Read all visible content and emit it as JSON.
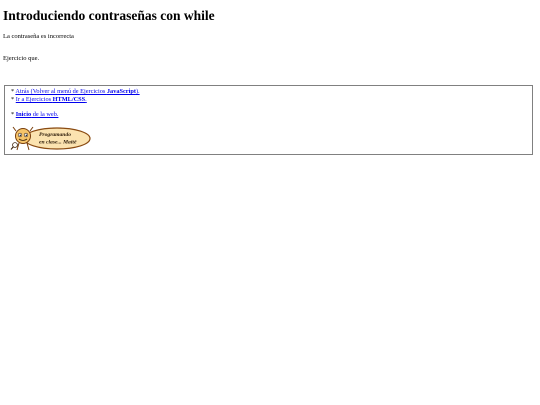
{
  "heading": "Introduciendo contraseñas con while",
  "message": "La contraseña es incorrecta",
  "exercise_text": "Ejercicio que.",
  "nav": {
    "bullet": "*",
    "back_link_text": "Atrás (Volver al menú de Ejercicios ",
    "back_link_bold": "JavaScript",
    "back_link_end": ").",
    "html_link_text": "Ir a Ejercicios ",
    "html_link_bold": "HTML/CSS",
    "html_link_end": ".",
    "home_link_bold": "Inicio",
    "home_link_text": " de la web."
  },
  "badge": {
    "line1": "Programando",
    "line2": "en clase... Maitê",
    "colors": {
      "fill": "#fbe3b0",
      "stroke": "#8a4b12",
      "text": "#2b1a08"
    }
  }
}
